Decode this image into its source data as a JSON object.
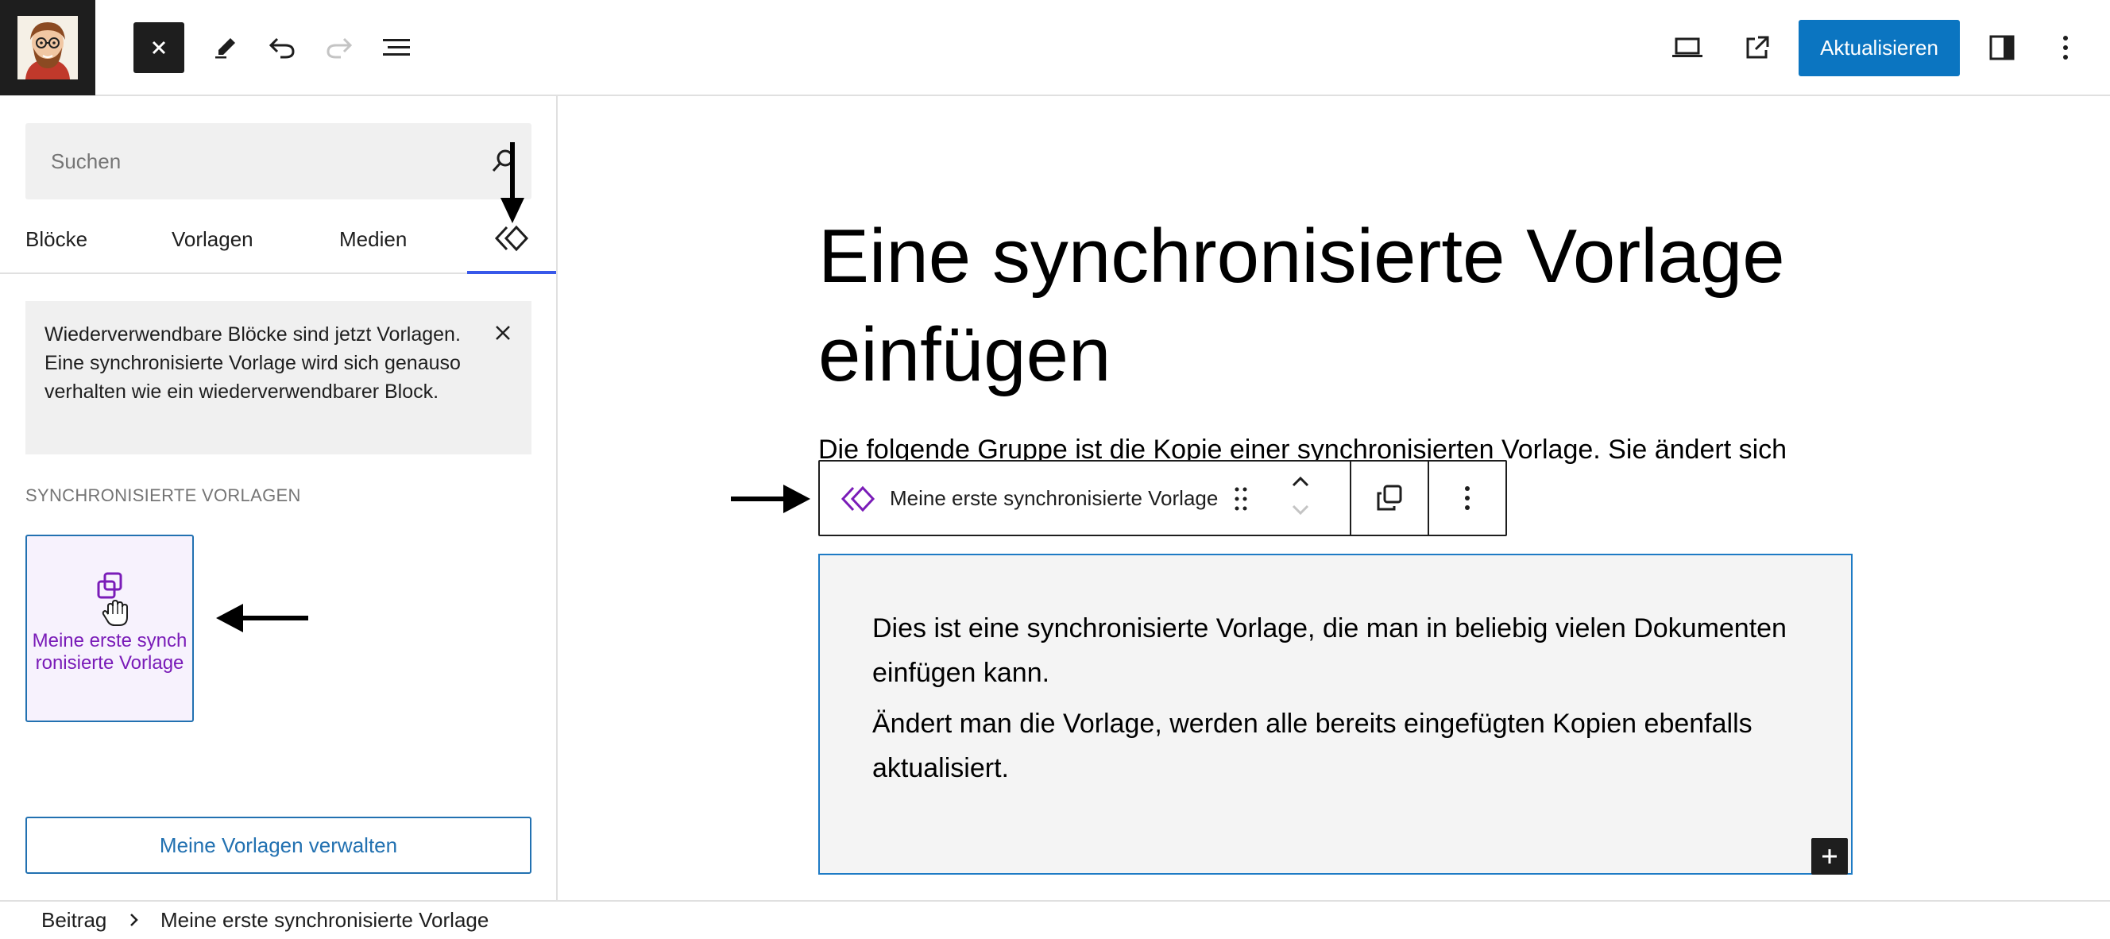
{
  "toolbar": {
    "update_label": "Aktualisieren",
    "icons": [
      "site-logo",
      "close-icon",
      "pencil-icon",
      "undo-icon",
      "redo-icon",
      "list-view-icon",
      "desktop-preview-icon",
      "external-link-icon",
      "sidebar-toggle-icon",
      "more-options-icon"
    ],
    "accent_color": "#0b75c1"
  },
  "sidebar": {
    "search": {
      "placeholder": "Suchen"
    },
    "tabs": [
      {
        "label": "Blöcke"
      },
      {
        "label": "Vorlagen"
      },
      {
        "label": "Medien"
      }
    ],
    "active_tab_icon": "synced-pattern-icon",
    "notice": {
      "text": "Wiederverwendbare Blöcke sind jetzt Vorlagen. Eine synchronisierte Vorlage wird sich genauso verhalten wie ein wiederverwendbarer Block."
    },
    "section_title": "Synchronisierte Vorlagen",
    "pattern": {
      "label": "Meine erste synchronisierte Vorlage",
      "color": "#7a1cb8"
    },
    "manage_label": "Meine Vorlagen verwalten"
  },
  "editor": {
    "title": "Eine synchronisierte Vorlage einfügen",
    "paragraph": "Die folgende Gruppe ist die Kopie einer synchronisierten Vorlage. Sie ändert sich",
    "block_toolbar": {
      "label": "Meine erste synchronisierte Vorlage"
    },
    "group": {
      "paragraphs": [
        "Dies ist eine synchronisierte Vorlage, die man in beliebig vielen Dokumenten einfügen kann.",
        "Ändert man die Vorlage, werden alle bereits eingefügten Kopien ebenfalls aktualisiert."
      ]
    }
  },
  "footer": {
    "breadcrumb": [
      "Beitrag",
      "Meine erste synchronisierte Vorlage"
    ]
  }
}
